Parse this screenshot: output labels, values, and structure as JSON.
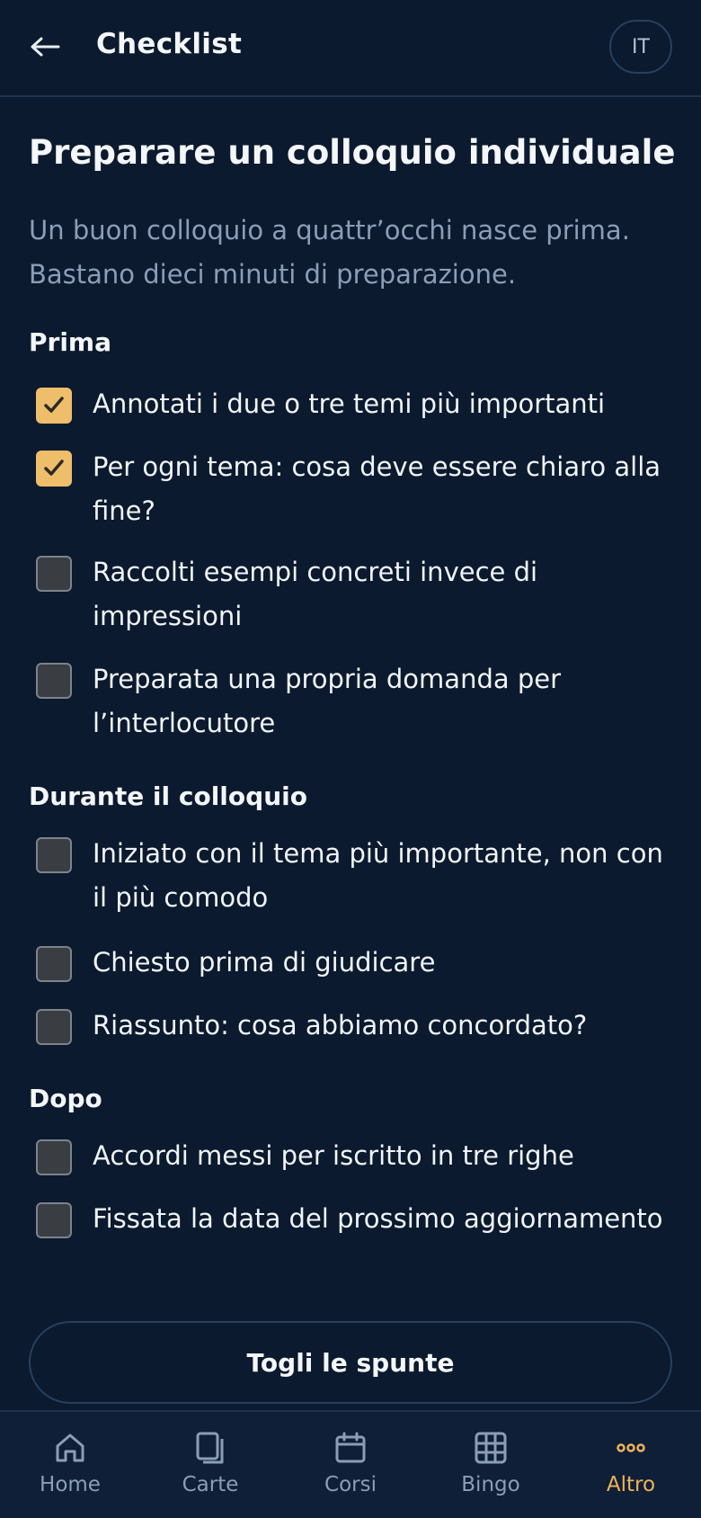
{
  "header": {
    "title": "Checklist",
    "language": "IT",
    "back_icon": "arrow-left-icon"
  },
  "page": {
    "title": "Preparare un colloquio individuale",
    "intro": "Un buon colloquio a quattr’occhi nasce prima. Bastano dieci minuti di preparazione."
  },
  "sections": [
    {
      "title": "Prima",
      "items": [
        {
          "text": "Annotati i due o tre temi più importanti",
          "checked": true
        },
        {
          "text": "Per ogni tema: cosa deve essere chiaro alla fine?",
          "checked": true
        },
        {
          "text": "Raccolti esempi concreti invece di impressioni",
          "checked": false
        },
        {
          "text": "Preparata una propria domanda per l’interlocutore",
          "checked": false
        }
      ]
    },
    {
      "title": "Durante il colloquio",
      "items": [
        {
          "text": "Iniziato con il tema più importante, non con il più comodo",
          "checked": false
        },
        {
          "text": "Chiesto prima di giudicare",
          "checked": false
        },
        {
          "text": "Riassunto: cosa abbiamo concordato?",
          "checked": false
        }
      ]
    },
    {
      "title": "Dopo",
      "items": [
        {
          "text": "Accordi messi per iscritto in tre righe",
          "checked": false
        },
        {
          "text": "Fissata la data del prossimo aggiornamento",
          "checked": false
        }
      ]
    }
  ],
  "reset_button": "Togli le spunte",
  "nav": [
    {
      "label": "Home",
      "icon": "home-icon",
      "active": false
    },
    {
      "label": "Carte",
      "icon": "cards-icon",
      "active": false
    },
    {
      "label": "Corsi",
      "icon": "calendar-icon",
      "active": false
    },
    {
      "label": "Bingo",
      "icon": "grid-icon",
      "active": false
    },
    {
      "label": "Altro",
      "icon": "more-dots-icon",
      "active": true
    }
  ],
  "colors": {
    "background": "#0b1a2e",
    "accent": "#efbe6a",
    "muted_text": "#8c9db6"
  }
}
